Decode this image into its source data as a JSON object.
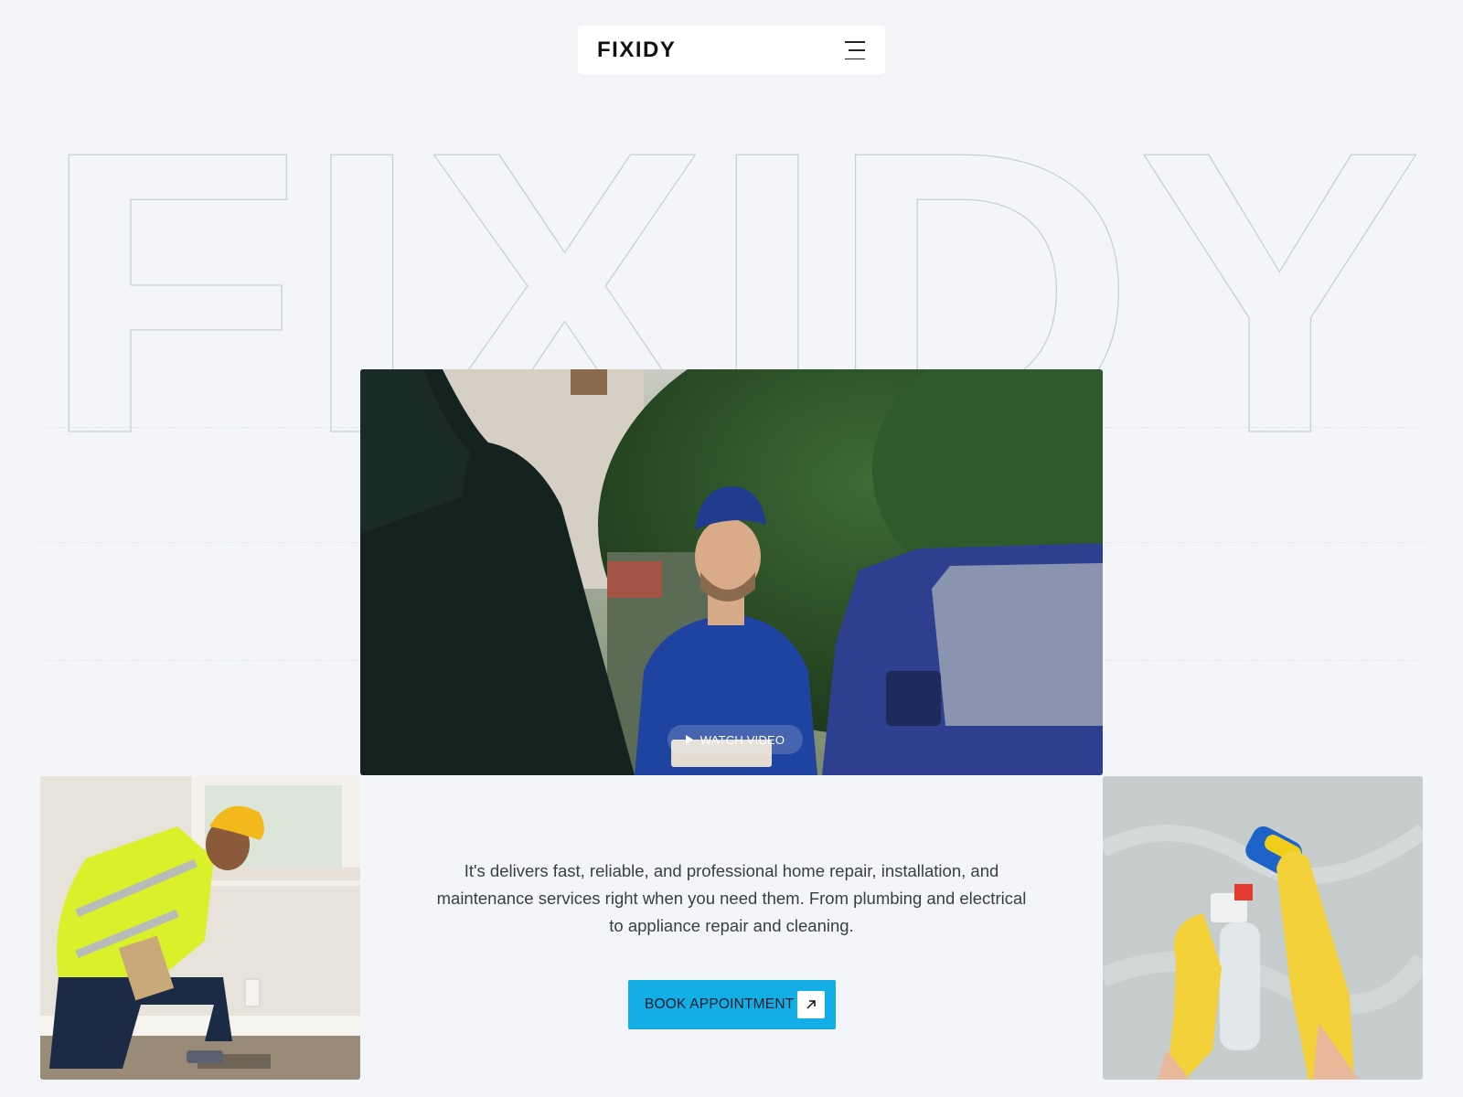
{
  "header": {
    "logo": "FIXIDY",
    "menu_icon": "hamburger-menu-icon"
  },
  "hero": {
    "outline_word": "FIXIDY"
  },
  "media": {
    "main_photo": "technician-smiling-near-van",
    "left_photo": "worker-in-hardhat-kneeling",
    "right_photo": "gloved-hands-cleaning-wall",
    "watch_label": "WATCH VIDEO",
    "play_icon": "play-icon"
  },
  "intro": {
    "text": "It's delivers fast, reliable, and professional home repair, installation, and maintenance services right when you need them. From plumbing and electrical to appliance repair and cleaning."
  },
  "cta": {
    "label": "BOOK APPOINTMENT",
    "icon": "arrow-up-right-icon"
  },
  "colors": {
    "background": "#f3f5f9",
    "accent": "#14aee6",
    "outline": "#c9cdd4"
  }
}
